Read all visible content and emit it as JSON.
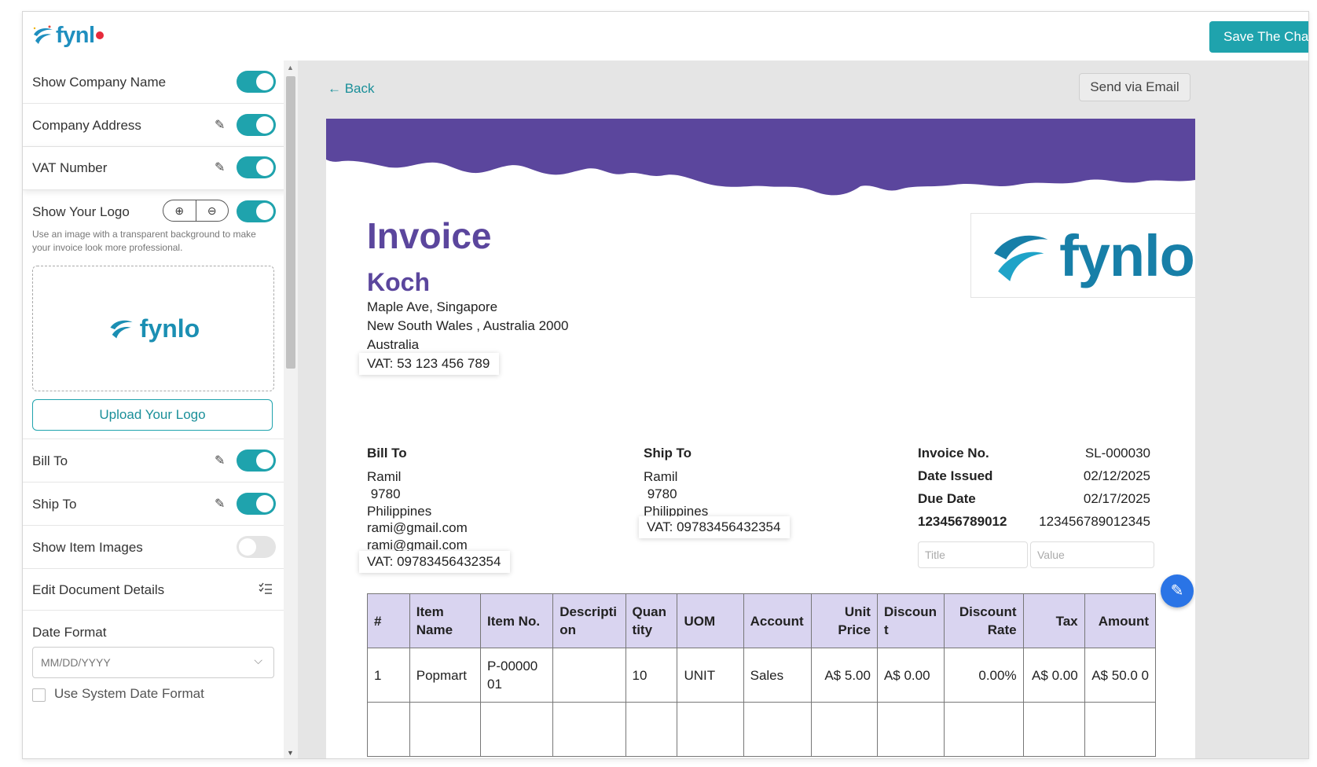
{
  "app": {
    "logo_text": "fynl",
    "save_button": "Save The Cha"
  },
  "sidebar": {
    "show_company_name": "Show Company Name",
    "company_address": "Company Address",
    "vat_number": "VAT Number",
    "show_your_logo": "Show Your Logo",
    "zoom_in_icon": "⊕",
    "zoom_out_icon": "⊖",
    "logo_hint": "Use an image with a transparent background to make your invoice look more professional.",
    "preview_logo_text": "fynlo",
    "upload_logo": "Upload Your Logo",
    "bill_to": "Bill To",
    "ship_to": "Ship To",
    "show_item_images": "Show Item Images",
    "edit_document_details": "Edit Document Details",
    "date_format_label": "Date Format",
    "date_format_value": "MM/DD/YYYY",
    "use_system_date": "Use System Date Format",
    "toggles": {
      "show_company_name": true,
      "company_address": true,
      "vat_number": true,
      "show_your_logo": true,
      "bill_to": true,
      "ship_to": true,
      "show_item_images": false
    }
  },
  "main": {
    "back": "← Back",
    "send_email": "Send via Email"
  },
  "invoice": {
    "title": "Invoice",
    "company_name": "Koch",
    "address": [
      "Maple Ave, Singapore",
      "New South Wales , Australia 2000",
      "Australia"
    ],
    "company_vat": "VAT: 53 123 456 789",
    "logo_text": "fynlo",
    "bill_to": {
      "heading": "Bill To",
      "lines": [
        "Ramil",
        " 9780",
        "Philippines",
        "rami@gmail.com",
        "rami@gmail.com"
      ],
      "vat": "VAT: 09783456432354"
    },
    "ship_to": {
      "heading": "Ship To",
      "lines": [
        "Ramil",
        " 9780",
        "Philippines"
      ],
      "vat": "VAT: 09783456432354"
    },
    "meta": [
      {
        "label": "Invoice No.",
        "value": "SL-000030"
      },
      {
        "label": "Date Issued",
        "value": "02/12/2025"
      },
      {
        "label": "Due Date",
        "value": "02/17/2025"
      },
      {
        "label": "123456789012",
        "value": "123456789012345"
      }
    ],
    "custom_title_placeholder": "Title",
    "custom_value_placeholder": "Value",
    "table": {
      "headers": [
        "#",
        "Item Name",
        "Item No.",
        "Descripti on",
        "Quan tity",
        "UOM",
        "Account",
        "Unit Price",
        "Discoun t",
        "Discount Rate",
        "Tax",
        "Amount"
      ],
      "rows": [
        [
          "1",
          "Popmart",
          "P-00000 01",
          "",
          "10",
          "UNIT",
          "Sales",
          "A$ 5.00",
          "A$ 0.00",
          "0.00%",
          "A$ 0.00",
          "A$ 50.0 0"
        ]
      ]
    }
  },
  "colors": {
    "accent": "#1fa3ad",
    "invoice_purple": "#5b469d",
    "wave": "#5b469d",
    "header_cell": "#d9d4f0"
  }
}
